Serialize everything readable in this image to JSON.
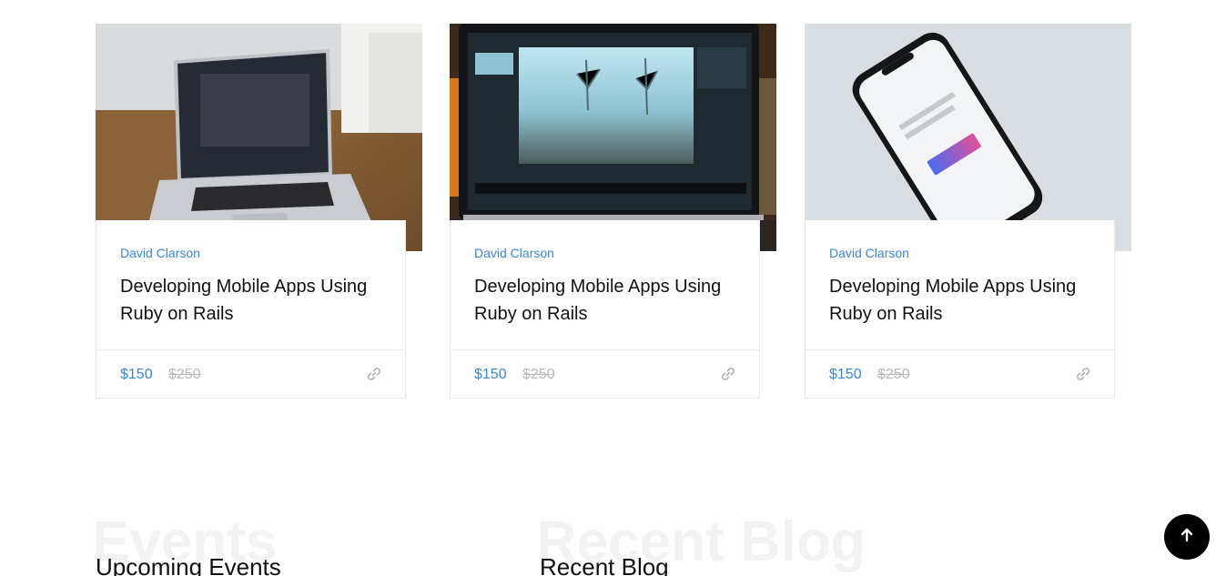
{
  "courses": [
    {
      "author": "David Clarson",
      "title": "Developing Mobile Apps Using Ruby on Rails",
      "price": "$150",
      "old_price": "$250",
      "image": "laptop-on-desk-image"
    },
    {
      "author": "David Clarson",
      "title": "Developing Mobile Apps Using Ruby on Rails",
      "price": "$150",
      "old_price": "$250",
      "image": "photo-editing-laptop-image"
    },
    {
      "author": "David Clarson",
      "title": "Developing Mobile Apps Using Ruby on Rails",
      "price": "$150",
      "old_price": "$250",
      "image": "smartphone-app-image"
    }
  ],
  "events": {
    "bg_title": "Events",
    "heading": "Upcoming Events"
  },
  "blog": {
    "bg_title": "Recent Blog",
    "heading": "Recent Blog"
  },
  "colors": {
    "accent": "#3a86d8",
    "muted": "#b8b8b8",
    "title": "#111111"
  },
  "icons": {
    "card_link": "link-icon",
    "scroll_top": "arrow-up-icon"
  }
}
